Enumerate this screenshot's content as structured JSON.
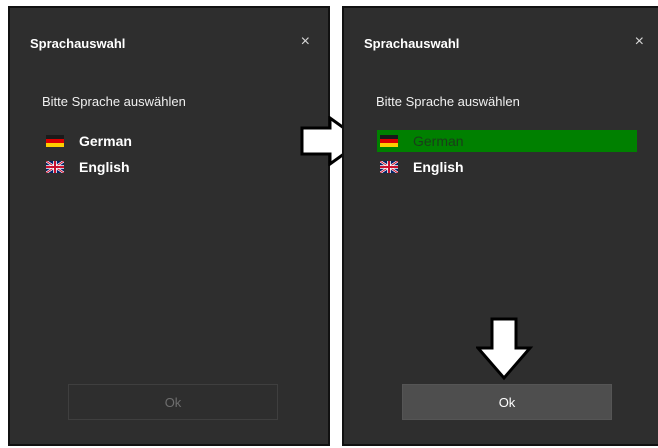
{
  "left_dialog": {
    "title": "Sprachauswahl",
    "close_glyph": "×",
    "prompt": "Bitte Sprache auswählen",
    "languages": [
      {
        "label": "German",
        "flag": "de-flag-icon"
      },
      {
        "label": "English",
        "flag": "uk-flag-icon"
      }
    ],
    "ok_label": "Ok",
    "ok_state": "disabled"
  },
  "right_dialog": {
    "title": "Sprachauswahl",
    "close_glyph": "×",
    "prompt": "Bitte Sprache auswählen",
    "languages": [
      {
        "label": "German",
        "flag": "de-flag-icon",
        "selected": true
      },
      {
        "label": "English",
        "flag": "uk-flag-icon"
      }
    ],
    "ok_label": "Ok",
    "ok_state": "enabled"
  },
  "colors": {
    "dialog_bg": "#2e2e2e",
    "selection": "#008000",
    "ok_enabled_bg": "#4e4e4e"
  },
  "annotations": [
    "right-arrow-icon",
    "down-arrow-icon"
  ]
}
